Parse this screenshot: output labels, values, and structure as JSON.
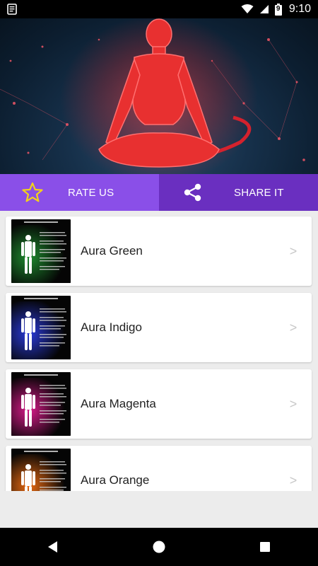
{
  "status_bar": {
    "time": "9:10",
    "battery_level": "9"
  },
  "banner": {
    "image": "meditation-figure-red-aura"
  },
  "actions": {
    "rate_label": "RATE US",
    "share_label": "SHARE IT",
    "rate_icon": "star-icon",
    "share_icon": "share-icon"
  },
  "list": {
    "items": [
      {
        "title": "Aura Green",
        "color": "#1e8a2e"
      },
      {
        "title": "Aura Indigo",
        "color": "#2a3ad8"
      },
      {
        "title": "Aura Magenta",
        "color": "#d81a8a"
      },
      {
        "title": "Aura Orange",
        "color": "#e86a12"
      }
    ],
    "chevron": ">"
  },
  "colors": {
    "rate_bg": "#8a4fe8",
    "share_bg": "#6a2fc0",
    "aura_red": "#e83030"
  }
}
